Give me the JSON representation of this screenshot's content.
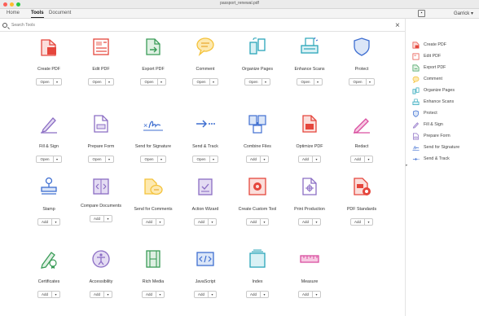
{
  "window": {
    "title": "passport_renewal.pdf"
  },
  "menu": {
    "home": "Home",
    "tools": "Tools",
    "document": "Document",
    "user": "Garrick",
    "user_caret": "▾"
  },
  "search": {
    "placeholder": "Search Tools",
    "clear": "×"
  },
  "panel_handle": "▸",
  "colors": {
    "red": "#e5463c",
    "purple": "#8b6dc4",
    "green": "#3a9c58",
    "yellow": "#f4c23a",
    "teal": "#2aa5b9",
    "blue": "#3f6fd1"
  },
  "tools": [
    {
      "name": "Create PDF",
      "button": "Open",
      "icon": "create-pdf-icon"
    },
    {
      "name": "Edit PDF",
      "button": "Open",
      "icon": "edit-pdf-icon"
    },
    {
      "name": "Export PDF",
      "button": "Open",
      "icon": "export-pdf-icon"
    },
    {
      "name": "Comment",
      "button": "Open",
      "icon": "comment-icon"
    },
    {
      "name": "Organize Pages",
      "button": "Open",
      "icon": "organize-pages-icon"
    },
    {
      "name": "Enhance Scans",
      "button": "Open",
      "icon": "enhance-scans-icon"
    },
    {
      "name": "Protect",
      "button": "Open",
      "icon": "protect-icon"
    },
    {
      "name": "Fill & Sign",
      "button": "Open",
      "icon": "fill-sign-icon"
    },
    {
      "name": "Prepare Form",
      "button": "Open",
      "icon": "prepare-form-icon"
    },
    {
      "name": "Send for Signature",
      "button": "Open",
      "icon": "send-for-signature-icon"
    },
    {
      "name": "Send & Track",
      "button": "Open",
      "icon": "send-track-icon"
    },
    {
      "name": "Combine Files",
      "button": "Add",
      "icon": "combine-files-icon"
    },
    {
      "name": "Optimize PDF",
      "button": "Add",
      "icon": "optimize-pdf-icon"
    },
    {
      "name": "Redact",
      "button": "Add",
      "icon": "redact-icon"
    },
    {
      "name": "Stamp",
      "button": "Add",
      "icon": "stamp-icon"
    },
    {
      "name": "Compare Documents",
      "button": "Add",
      "icon": "compare-documents-icon"
    },
    {
      "name": "Send for Comments",
      "button": "Add",
      "icon": "send-for-comments-icon"
    },
    {
      "name": "Action Wizard",
      "button": "Add",
      "icon": "action-wizard-icon"
    },
    {
      "name": "Create Custom Tool",
      "button": "Add",
      "icon": "create-custom-tool-icon"
    },
    {
      "name": "Print Production",
      "button": "Add",
      "icon": "print-production-icon"
    },
    {
      "name": "PDF Standards",
      "button": "Add",
      "icon": "pdf-standards-icon"
    },
    {
      "name": "Certificates",
      "button": "Add",
      "icon": "certificates-icon"
    },
    {
      "name": "Accessibility",
      "button": "Add",
      "icon": "accessibility-icon"
    },
    {
      "name": "Rich Media",
      "button": "Add",
      "icon": "rich-media-icon"
    },
    {
      "name": "JavaScript",
      "button": "Add",
      "icon": "javascript-icon"
    },
    {
      "name": "Index",
      "button": "Add",
      "icon": "index-icon"
    },
    {
      "name": "Measure",
      "button": "Add",
      "icon": "measure-icon"
    }
  ],
  "button_caret": "▾",
  "right_panel": [
    {
      "label": "Create PDF",
      "icon": "create-pdf-icon"
    },
    {
      "label": "Edit PDF",
      "icon": "edit-pdf-icon"
    },
    {
      "label": "Export PDF",
      "icon": "export-pdf-icon"
    },
    {
      "label": "Comment",
      "icon": "comment-icon"
    },
    {
      "label": "Organize Pages",
      "icon": "organize-pages-icon"
    },
    {
      "label": "Enhance Scans",
      "icon": "enhance-scans-icon"
    },
    {
      "label": "Protect",
      "icon": "protect-icon"
    },
    {
      "label": "Fill & Sign",
      "icon": "fill-sign-icon"
    },
    {
      "label": "Prepare Form",
      "icon": "prepare-form-icon"
    },
    {
      "label": "Send for Signature",
      "icon": "send-for-signature-icon"
    },
    {
      "label": "Send & Track",
      "icon": "send-track-icon"
    }
  ]
}
